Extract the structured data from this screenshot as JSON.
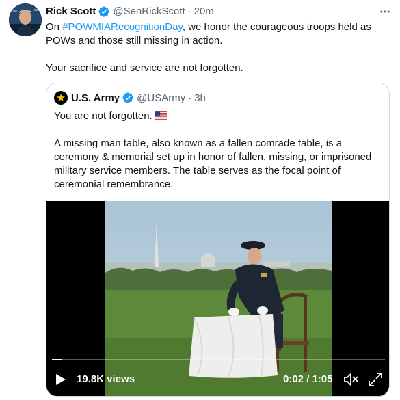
{
  "tweet": {
    "author_name": "Rick Scott",
    "handle": "@SenRickScott",
    "separator": "·",
    "time": "20m",
    "text_before_hashtag": "On ",
    "hashtag": "#POWMIARecognitionDay",
    "text_after_hashtag": ", we honor the courageous troops held as POWs and those still missing in action.",
    "text_second": "Your sacrifice and service are not forgotten.",
    "more_icon": "more-horizontal-icon"
  },
  "quote": {
    "author_name": "U.S. Army",
    "handle": "@USArmy",
    "separator": "·",
    "time": "3h",
    "line1": "You are not forgotten.",
    "flag_icon": "us-flag-icon",
    "paragraph": "A missing man table, also known as a fallen comrade table, is a ceremony & memorial set up in honor of fallen, missing, or imprisoned military service members. The table serves as the focal point of ceremonial remembrance."
  },
  "video": {
    "views": "19.8K views",
    "current_time": "0:02",
    "time_separator": " / ",
    "duration": "1:05",
    "progress": 0.03
  },
  "colors": {
    "accent": "#1d9bf0",
    "text": "#0f1419",
    "muted": "#536471",
    "border": "#cfd9de"
  }
}
